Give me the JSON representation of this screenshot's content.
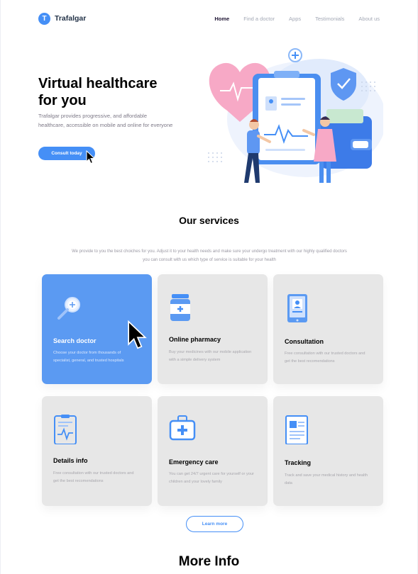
{
  "nav": {
    "brand_initial": "T",
    "brand_name": "Trafalgar",
    "links": [
      "Home",
      "Find a doctor",
      "Apps",
      "Testimonials",
      "About us"
    ],
    "active": "Home"
  },
  "hero": {
    "title_line1": "Virtual healthcare",
    "title_line2": "for you",
    "subtitle": "Trafalgar provides progressive, and affordable healthcare, accessible on mobile and online for everyone",
    "cta_label": "Consult today"
  },
  "services": {
    "title": "Our services",
    "description": "We provide to you the best choiches for you. Adjust it to your health needs and make sure your undergo treatment with our highly qualified doctors you can consult with us which type of service is suitable for your health",
    "cards": [
      {
        "title": "Search doctor",
        "text": "Choose your doctor from thousands of specialist, general, and trusted hospitals",
        "icon": "search-icon",
        "active": true
      },
      {
        "title": "Online pharmacy",
        "text": "Buy your medicines with our mobile application with a simple delivery system",
        "icon": "pill-bottle-icon",
        "active": false
      },
      {
        "title": "Consultation",
        "text": "Free consultation with our trusted doctors and get the best recomendations",
        "icon": "tablet-doctor-icon",
        "active": false
      },
      {
        "title": "Details info",
        "text": "Free consultation with our trusted doctors and get the best recomendations",
        "icon": "clipboard-heartbeat-icon",
        "active": false
      },
      {
        "title": "Emergency care",
        "text": "You can get 24/7 urgent care for yourself or your children and your lovely family",
        "icon": "first-aid-kit-icon",
        "active": false
      },
      {
        "title": "Tracking",
        "text": "Track and save your medical history and health data",
        "icon": "document-icon",
        "active": false
      }
    ],
    "learn_more_label": "Learn more"
  },
  "more_info": {
    "title": "More Info"
  },
  "colors": {
    "primary": "#458ff6",
    "card_active": "#5b9af2",
    "card_bg": "#e7e7e7",
    "heading": "#000000",
    "muted": "#7d7987"
  }
}
